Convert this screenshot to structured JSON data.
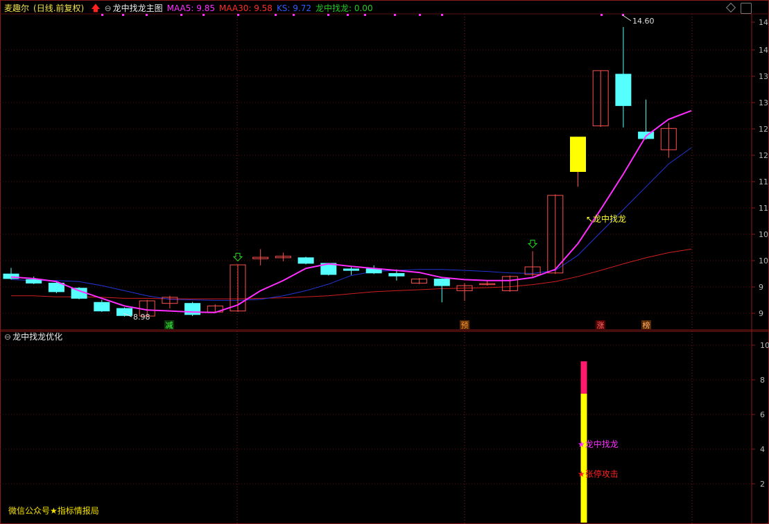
{
  "header": {
    "stock_name": "麦趣尔",
    "period": "(日线.前复权)",
    "arrow_icon": "red-up-arrow-icon",
    "indicator_name": "龙中找龙主图",
    "maa5_label": "MAA5: 9.85",
    "maa30_label": "MAA30: 9.58",
    "ks_label": "KS: 9.72",
    "lzzl_label": "龙中找龙: 0.00",
    "colors": {
      "maa5": "#ff2dff",
      "maa30": "#ff2b2b",
      "ks": "#2f5bff",
      "lzzl": "#22cc22"
    }
  },
  "sub_header": {
    "indicator_name": "龙中找龙优化"
  },
  "watermark": "微信公众号★指标情报局",
  "signals": {
    "jian": "减",
    "yu": "预",
    "zhang": "涨",
    "bang": "榜",
    "lzzl_yellow": "龙中找龙",
    "lzzl_magenta": "★龙中找龙",
    "zhangting": "★张停攻击"
  },
  "price_labels": {
    "high": "14.60",
    "low": "8.98"
  },
  "y_ticks_main": [
    "14",
    "14",
    "13",
    "13",
    "12",
    "12",
    "11",
    "11",
    "10",
    "10",
    "9",
    "9"
  ],
  "y_ticks_sub": [
    "10",
    "8",
    "6",
    "4",
    "2"
  ],
  "chart_data": [
    {
      "type": "candlestick",
      "title": "龙中找龙主图",
      "ylim": [
        8.9,
        14.75
      ],
      "candles": [
        {
          "o": 9.73,
          "c": 9.64,
          "h": 9.85,
          "l": 9.62
        },
        {
          "o": 9.62,
          "c": 9.55,
          "h": 9.68,
          "l": 9.53
        },
        {
          "o": 9.55,
          "c": 9.38,
          "h": 9.58,
          "l": 9.35
        },
        {
          "o": 9.45,
          "c": 9.25,
          "h": 9.47,
          "l": 9.23
        },
        {
          "o": 9.17,
          "c": 9.0,
          "h": 9.22,
          "l": 8.98
        },
        {
          "o": 9.05,
          "c": 8.91,
          "h": 9.07,
          "l": 8.89
        },
        {
          "o": 8.9,
          "c": 9.2,
          "h": 9.22,
          "l": 8.88
        },
        {
          "o": 9.15,
          "c": 9.27,
          "h": 9.3,
          "l": 9.05
        },
        {
          "o": 9.15,
          "c": 8.93,
          "h": 9.18,
          "l": 8.9
        },
        {
          "o": 8.98,
          "c": 9.1,
          "h": 9.13,
          "l": 8.96
        },
        {
          "o": 9.0,
          "c": 9.91,
          "h": 9.92,
          "l": 8.98
        },
        {
          "o": 10.03,
          "c": 10.06,
          "h": 10.22,
          "l": 9.9
        },
        {
          "o": 10.05,
          "c": 10.08,
          "h": 10.15,
          "l": 9.98
        },
        {
          "o": 10.05,
          "c": 9.94,
          "h": 10.07,
          "l": 9.92
        },
        {
          "o": 9.94,
          "c": 9.72,
          "h": 9.95,
          "l": 9.7
        },
        {
          "o": 9.83,
          "c": 9.8,
          "h": 9.88,
          "l": 9.71
        },
        {
          "o": 9.83,
          "c": 9.75,
          "h": 9.9,
          "l": 9.73
        },
        {
          "o": 9.74,
          "c": 9.69,
          "h": 9.82,
          "l": 9.6
        },
        {
          "o": 9.55,
          "c": 9.63,
          "h": 9.65,
          "l": 9.53
        },
        {
          "o": 9.63,
          "c": 9.5,
          "h": 9.64,
          "l": 9.17
        },
        {
          "o": 9.4,
          "c": 9.5,
          "h": 9.55,
          "l": 9.2
        },
        {
          "o": 9.52,
          "c": 9.54,
          "h": 9.6,
          "l": 9.5
        },
        {
          "o": 9.4,
          "c": 9.68,
          "h": 9.7,
          "l": 9.38
        },
        {
          "o": 9.72,
          "c": 9.87,
          "h": 10.18,
          "l": 9.68
        },
        {
          "o": 9.75,
          "c": 11.28,
          "h": 11.3,
          "l": 9.73
        },
        {
          "o": 12.43,
          "c": 11.75,
          "h": 12.43,
          "l": 11.45,
          "limit_up": true
        },
        {
          "o": 12.65,
          "c": 13.74,
          "h": 13.74,
          "l": 12.63
        },
        {
          "o": 13.67,
          "c": 13.05,
          "h": 14.6,
          "l": 12.62
        },
        {
          "o": 12.53,
          "c": 12.4,
          "h": 13.17,
          "l": 12.38
        },
        {
          "o": 12.18,
          "c": 12.6,
          "h": 12.71,
          "l": 12.02
        }
      ],
      "maa5": [
        9.67,
        9.64,
        9.58,
        9.4,
        9.25,
        9.1,
        9.02,
        9.0,
        8.98,
        8.97,
        9.12,
        9.4,
        9.6,
        9.84,
        9.93,
        9.88,
        9.84,
        9.8,
        9.76,
        9.66,
        9.62,
        9.6,
        9.6,
        9.66,
        9.82,
        10.33,
        11.0,
        11.7,
        12.45,
        12.78,
        12.95
      ],
      "maa30": [
        9.3,
        9.3,
        9.28,
        9.28,
        9.27,
        9.25,
        9.25,
        9.24,
        9.24,
        9.24,
        9.24,
        9.25,
        9.26,
        9.28,
        9.3,
        9.34,
        9.38,
        9.4,
        9.42,
        9.44,
        9.45,
        9.46,
        9.48,
        9.52,
        9.58,
        9.68,
        9.8,
        9.93,
        10.05,
        10.15,
        10.22
      ],
      "ks": [
        9.62,
        9.6,
        9.6,
        9.58,
        9.5,
        9.4,
        9.3,
        9.23,
        9.22,
        9.21,
        9.21,
        9.23,
        9.3,
        9.4,
        9.53,
        9.7,
        9.78,
        9.8,
        9.82,
        9.82,
        9.8,
        9.78,
        9.75,
        9.74,
        9.8,
        10.1,
        10.55,
        11.0,
        11.45,
        11.9,
        12.22
      ],
      "signals": [
        {
          "idx": 10,
          "type": "buy_arrow"
        },
        {
          "idx": 23,
          "type": "buy_arrow"
        }
      ]
    },
    {
      "type": "bar",
      "title": "龙中找龙优化",
      "ylim": [
        0,
        11
      ],
      "bars": [
        {
          "idx": 25,
          "segments": [
            {
              "from": 0,
              "to": 8,
              "color": "#ffff00"
            },
            {
              "from": 8,
              "to": 10,
              "color": "#ff1a6e"
            }
          ]
        }
      ]
    }
  ]
}
